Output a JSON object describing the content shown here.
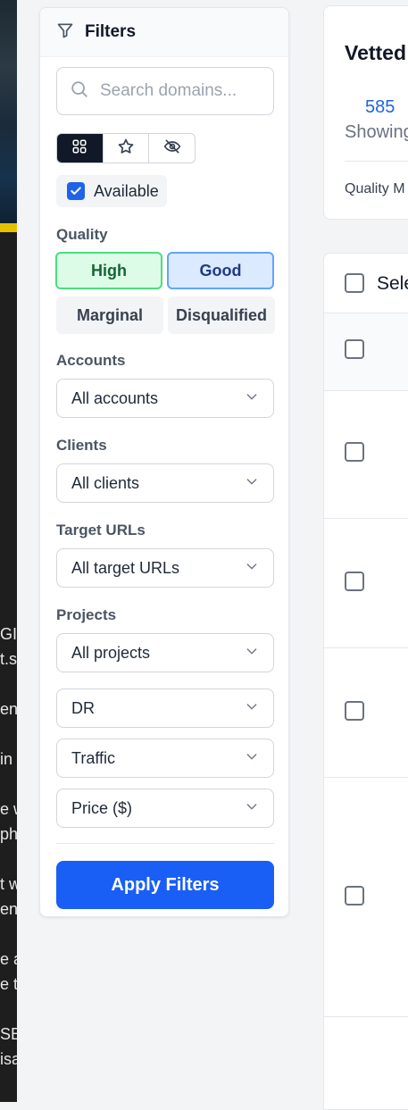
{
  "background_window": {
    "lines": [
      "GI",
      "t.s",
      "",
      "en",
      "",
      "in",
      "",
      "e w",
      "ph",
      "",
      "t w",
      "en",
      "",
      "e a",
      "e t",
      "",
      "SE",
      "isa"
    ]
  },
  "filters": {
    "title": "Filters",
    "search": {
      "placeholder": "Search domains..."
    },
    "view_modes": [
      "grid-icon",
      "star-icon",
      "eye-off-icon"
    ],
    "available": {
      "label": "Available",
      "checked": true
    },
    "quality": {
      "label": "Quality",
      "options": [
        "High",
        "Good",
        "Marginal",
        "Disqualified"
      ],
      "selected": [
        "High",
        "Good"
      ]
    },
    "accounts": {
      "label": "Accounts",
      "value": "All accounts"
    },
    "clients": {
      "label": "Clients",
      "value": "All clients"
    },
    "target_urls": {
      "label": "Target URLs",
      "value": "All target URLs"
    },
    "projects": {
      "label": "Projects",
      "value": "All projects"
    },
    "dr": {
      "value": "DR"
    },
    "traffic": {
      "value": "Traffic"
    },
    "price": {
      "value": "Price ($)"
    },
    "apply_label": "Apply Filters"
  },
  "summary": {
    "title": "Vetted",
    "count": "585",
    "count_label": "Showing",
    "quality_label": "Quality M"
  },
  "table": {
    "select_all_label": "Sele"
  },
  "colors": {
    "primary": "#1a5ff5",
    "high_bg": "#dcfce7",
    "good_bg": "#dbeafe"
  }
}
